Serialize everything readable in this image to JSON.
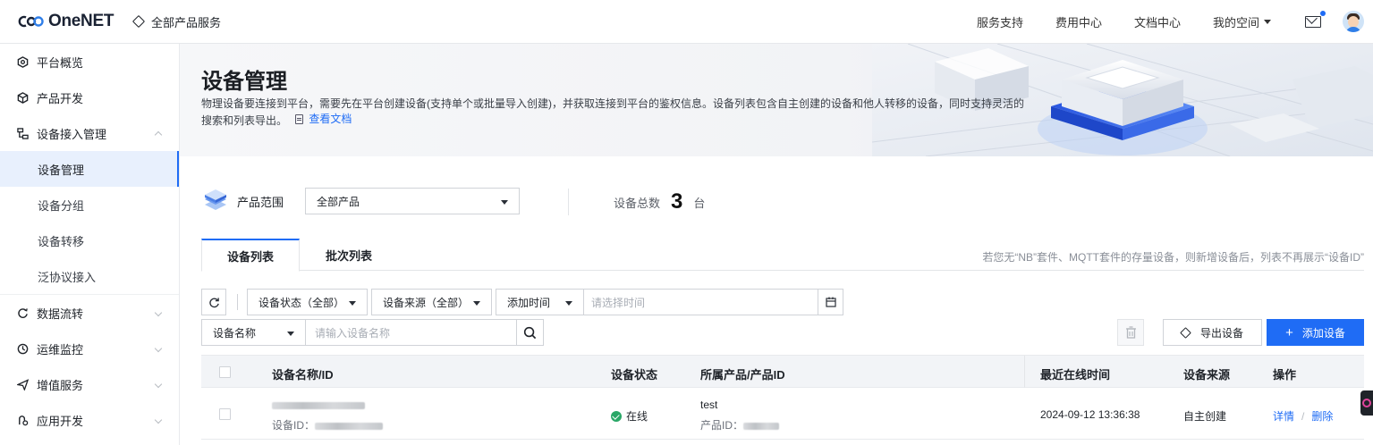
{
  "header": {
    "logo_text": "OneNET",
    "all_products": "全部产品服务",
    "links": [
      "服务支持",
      "费用中心",
      "文档中心"
    ],
    "my_space": "我的空间"
  },
  "sidebar": {
    "items": [
      {
        "label": "平台概览"
      },
      {
        "label": "产品开发"
      },
      {
        "label": "设备接入管理"
      },
      {
        "label": "数据流转"
      },
      {
        "label": "运维监控"
      },
      {
        "label": "增值服务"
      },
      {
        "label": "应用开发"
      }
    ],
    "sub_items": [
      {
        "label": "设备管理"
      },
      {
        "label": "设备分组"
      },
      {
        "label": "设备转移"
      },
      {
        "label": "泛协议接入"
      }
    ]
  },
  "banner": {
    "title": "设备管理",
    "desc_line1": "物理设备要连接到平台，需要先在平台创建设备(支持单个或批量导入创建)，并获取连接到平台的鉴权信息。设备列表包含自主创建的设备和他人转移的设备，同时支持灵活的",
    "desc_line2": "搜索和列表导出。",
    "doc_link": "查看文档"
  },
  "scope": {
    "label": "产品范围",
    "selected": "全部产品",
    "total_label": "设备总数",
    "total_count": "3",
    "total_unit": "台"
  },
  "tabs": {
    "items": [
      "设备列表",
      "批次列表"
    ],
    "hint": "若您无“NB”套件、MQTT套件的存量设备，则新增设备后，列表不再展示“设备ID”"
  },
  "filters": {
    "status": "设备状态（全部）",
    "source": "设备来源（全部）",
    "time_type": "添加时间",
    "time_placeholder": "请选择时间",
    "name_field": "设备名称",
    "name_placeholder": "请输入设备名称"
  },
  "actions": {
    "export": "导出设备",
    "add": "添加设备"
  },
  "table": {
    "columns": [
      "设备名称/ID",
      "设备状态",
      "所属产品/产品ID",
      "最近在线时间",
      "设备来源",
      "操作"
    ],
    "rows": [
      {
        "device_id_label": "设备ID：",
        "status": "在线",
        "product": "test",
        "product_id_label": "产品ID：",
        "last_online": "2024-09-12 13:36:38",
        "source": "自主创建",
        "op_detail": "详情",
        "op_sep": "/",
        "op_delete": "删除"
      }
    ]
  }
}
